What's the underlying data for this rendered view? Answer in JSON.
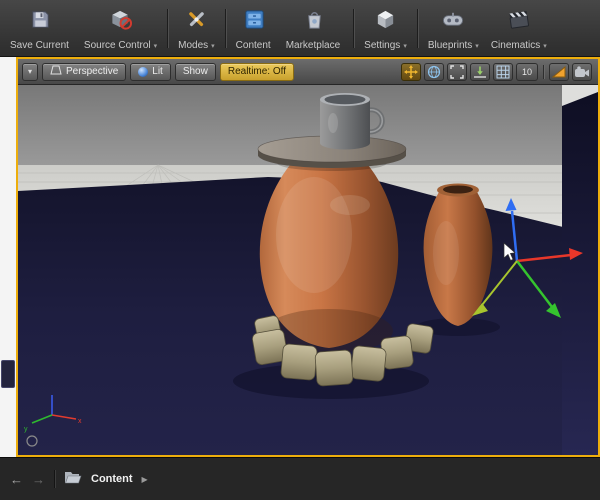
{
  "colors": {
    "viewport_border": "#EDAE0C",
    "realtime_button": "#D9B440",
    "shadow_blue": "#1E1E3C",
    "terracotta": "#C97545",
    "toolbar_background": "#3A3A3A"
  },
  "main_toolbar": {
    "items": [
      {
        "label": "Save Current",
        "caret": ""
      },
      {
        "label": "Source Control",
        "caret": "▾"
      },
      {
        "label": "Modes",
        "caret": "▾"
      },
      {
        "label": "Content",
        "caret": ""
      },
      {
        "label": "Marketplace",
        "caret": ""
      },
      {
        "label": "Settings",
        "caret": "▾"
      },
      {
        "label": "Blueprints",
        "caret": "▾"
      },
      {
        "label": "Cinematics",
        "caret": "▾"
      }
    ]
  },
  "viewport_toolbar": {
    "options_caret": "▾",
    "perspective": "Perspective",
    "lit": "Lit",
    "show": "Show",
    "realtime": "Realtime: Off",
    "grid_snap_value": "10"
  },
  "scene_overlay": {
    "axis_x": "x",
    "axis_y": "y"
  },
  "bottom_bar": {
    "back_arrow": "←",
    "forward_arrow": "→",
    "breadcrumb": "Content",
    "breadcrumb_caret": "▶"
  }
}
